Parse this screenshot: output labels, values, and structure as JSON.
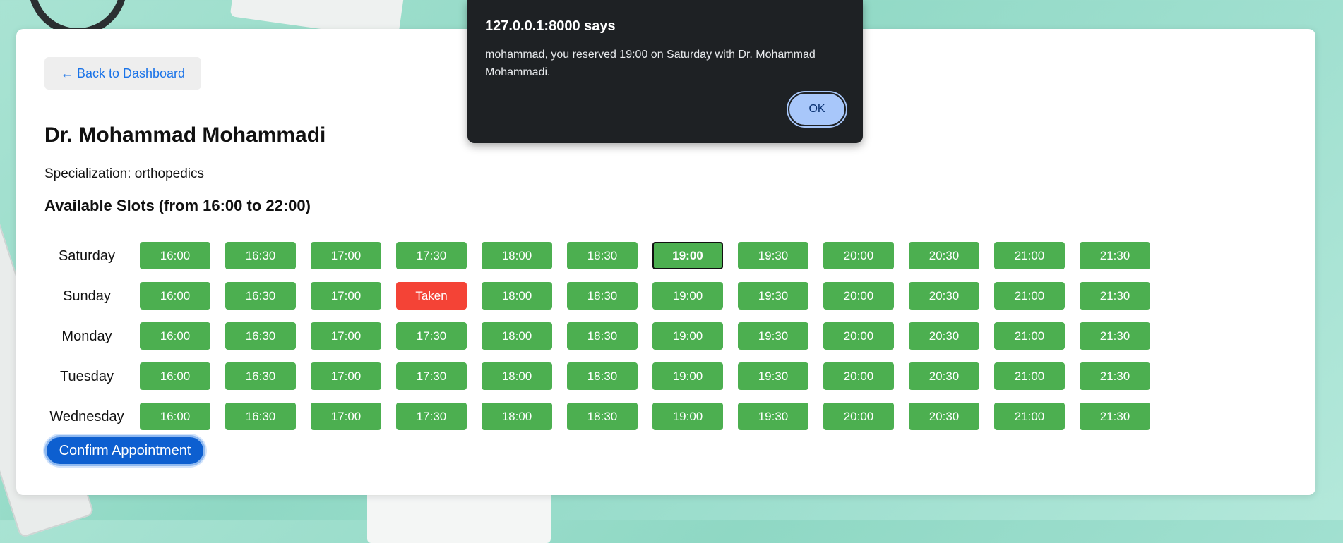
{
  "back_button": {
    "label": "← Back to Dashboard"
  },
  "doctor": {
    "name": "Dr. Mohammad Mohammadi",
    "specialization": "Specialization: orthopedics"
  },
  "slots_title": "Available Slots (from 16:00 to 22:00)",
  "times": [
    "16:00",
    "16:30",
    "17:00",
    "17:30",
    "18:00",
    "18:30",
    "19:00",
    "19:30",
    "20:00",
    "20:30",
    "21:00",
    "21:30"
  ],
  "days": [
    {
      "name": "Saturday",
      "slots": [
        "16:00",
        "16:30",
        "17:00",
        "17:30",
        "18:00",
        "18:30",
        "19:00",
        "19:30",
        "20:00",
        "20:30",
        "21:00",
        "21:30"
      ],
      "selected_index": 6
    },
    {
      "name": "Sunday",
      "slots": [
        "16:00",
        "16:30",
        "17:00",
        "Taken",
        "18:00",
        "18:30",
        "19:00",
        "19:30",
        "20:00",
        "20:30",
        "21:00",
        "21:30"
      ],
      "taken_index": 3
    },
    {
      "name": "Monday",
      "slots": [
        "16:00",
        "16:30",
        "17:00",
        "17:30",
        "18:00",
        "18:30",
        "19:00",
        "19:30",
        "20:00",
        "20:30",
        "21:00",
        "21:30"
      ]
    },
    {
      "name": "Tuesday",
      "slots": [
        "16:00",
        "16:30",
        "17:00",
        "17:30",
        "18:00",
        "18:30",
        "19:00",
        "19:30",
        "20:00",
        "20:30",
        "21:00",
        "21:30"
      ]
    },
    {
      "name": "Wednesday",
      "slots": [
        "16:00",
        "16:30",
        "17:00",
        "17:30",
        "18:00",
        "18:30",
        "19:00",
        "19:30",
        "20:00",
        "20:30",
        "21:00",
        "21:30"
      ]
    }
  ],
  "confirm_button": {
    "label": "Confirm Appointment"
  },
  "dialog": {
    "title": "127.0.0.1:8000 says",
    "message": "mohammad, you reserved 19:00 on Saturday with Dr. Mohammad Mohammadi.",
    "ok_label": "OK"
  },
  "colors": {
    "available": "#4caf50",
    "taken": "#f44336",
    "primary": "#0d5fd0",
    "link": "#1a73e8"
  }
}
